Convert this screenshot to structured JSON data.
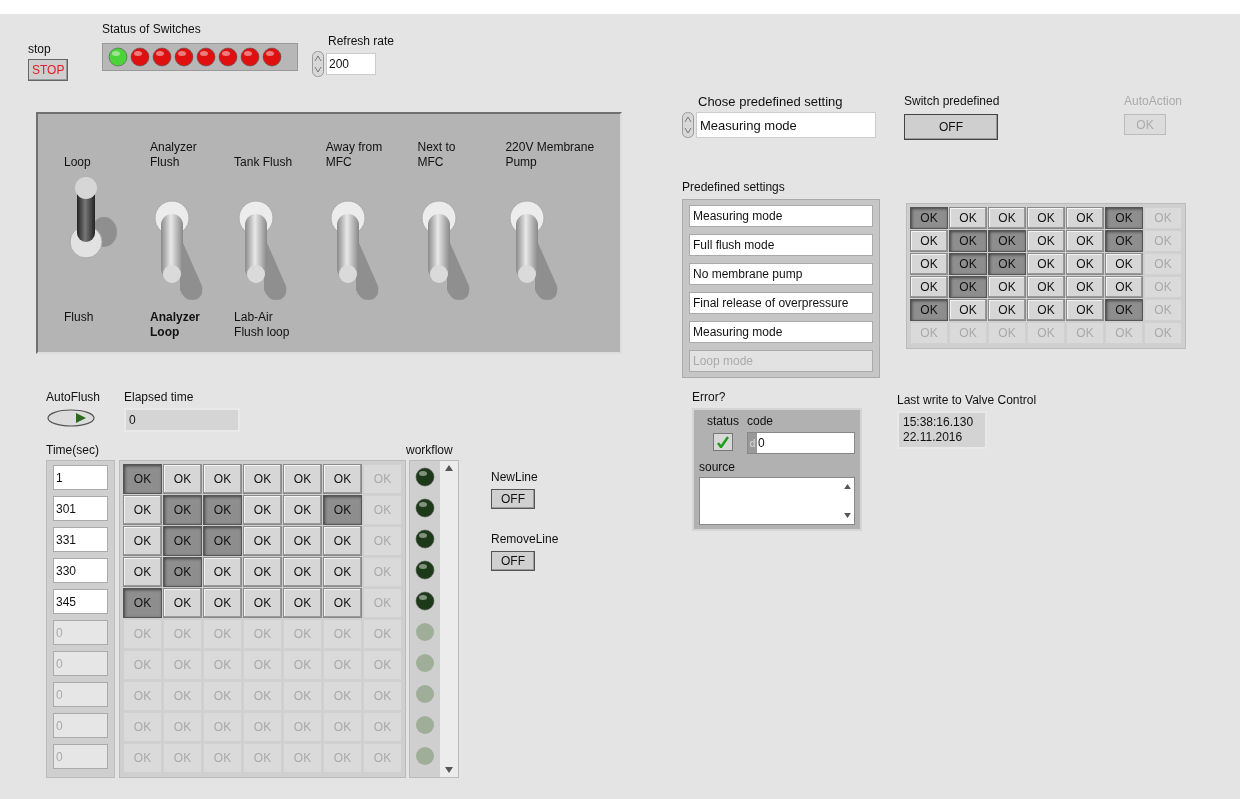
{
  "stop": {
    "label": "stop",
    "button": "STOP"
  },
  "status_of_switches": {
    "label": "Status of Switches",
    "leds": [
      {
        "on": true
      },
      {
        "on": false
      },
      {
        "on": false
      },
      {
        "on": false
      },
      {
        "on": false
      },
      {
        "on": false
      },
      {
        "on": false
      },
      {
        "on": false
      }
    ]
  },
  "refresh_rate": {
    "label": "Refresh rate",
    "value": "200"
  },
  "switches": [
    {
      "top": "Loop",
      "bottom": "Flush",
      "bottom_bold": false,
      "up": true
    },
    {
      "top": "Analyzer Flush",
      "bottom": "Analyzer Loop",
      "bottom_bold": true,
      "up": false
    },
    {
      "top": "Tank Flush",
      "bottom": "Lab-Air Flush loop",
      "bottom_bold": false,
      "up": false
    },
    {
      "top": "Away from MFC",
      "up": false
    },
    {
      "top": "Next to MFC",
      "up": false
    },
    {
      "top": "220V Membrane Pump",
      "up": false
    }
  ],
  "autoflush": {
    "label": "AutoFlush"
  },
  "elapsed_time": {
    "label": "Elapsed time",
    "value": "0"
  },
  "table": {
    "time_label": "Time(sec)",
    "workflow_label": "workflow",
    "rows": [
      {
        "time": "1",
        "disabled": false,
        "cells": [
          {
            "text": "OK",
            "pressed": true,
            "disabled": false
          },
          {
            "text": "OK",
            "pressed": false,
            "disabled": false
          },
          {
            "text": "OK",
            "pressed": false,
            "disabled": false
          },
          {
            "text": "OK",
            "pressed": false,
            "disabled": false
          },
          {
            "text": "OK",
            "pressed": false,
            "disabled": false
          },
          {
            "text": "OK",
            "pressed": false,
            "disabled": false
          },
          {
            "text": "OK",
            "pressed": false,
            "disabled": true
          }
        ]
      },
      {
        "time": "301",
        "disabled": false,
        "cells": [
          {
            "text": "OK",
            "pressed": false,
            "disabled": false
          },
          {
            "text": "OK",
            "pressed": true,
            "disabled": false
          },
          {
            "text": "OK",
            "pressed": true,
            "disabled": false
          },
          {
            "text": "OK",
            "pressed": false,
            "disabled": false
          },
          {
            "text": "OK",
            "pressed": false,
            "disabled": false
          },
          {
            "text": "OK",
            "pressed": true,
            "disabled": false
          },
          {
            "text": "OK",
            "pressed": false,
            "disabled": true
          }
        ]
      },
      {
        "time": "331",
        "disabled": false,
        "cells": [
          {
            "text": "OK",
            "pressed": false,
            "disabled": false
          },
          {
            "text": "OK",
            "pressed": true,
            "disabled": false
          },
          {
            "text": "OK",
            "pressed": true,
            "disabled": false
          },
          {
            "text": "OK",
            "pressed": false,
            "disabled": false
          },
          {
            "text": "OK",
            "pressed": false,
            "disabled": false
          },
          {
            "text": "OK",
            "pressed": false,
            "disabled": false
          },
          {
            "text": "OK",
            "pressed": false,
            "disabled": true
          }
        ]
      },
      {
        "time": "330",
        "disabled": false,
        "cells": [
          {
            "text": "OK",
            "pressed": false,
            "disabled": false
          },
          {
            "text": "OK",
            "pressed": true,
            "disabled": false
          },
          {
            "text": "OK",
            "pressed": false,
            "disabled": false
          },
          {
            "text": "OK",
            "pressed": false,
            "disabled": false
          },
          {
            "text": "OK",
            "pressed": false,
            "disabled": false
          },
          {
            "text": "OK",
            "pressed": false,
            "disabled": false
          },
          {
            "text": "OK",
            "pressed": false,
            "disabled": true
          }
        ]
      },
      {
        "time": "345",
        "disabled": false,
        "cells": [
          {
            "text": "OK",
            "pressed": true,
            "disabled": false
          },
          {
            "text": "OK",
            "pressed": false,
            "disabled": false
          },
          {
            "text": "OK",
            "pressed": false,
            "disabled": false
          },
          {
            "text": "OK",
            "pressed": false,
            "disabled": false
          },
          {
            "text": "OK",
            "pressed": false,
            "disabled": false
          },
          {
            "text": "OK",
            "pressed": false,
            "disabled": false
          },
          {
            "text": "OK",
            "pressed": false,
            "disabled": true
          }
        ]
      },
      {
        "time": "0",
        "disabled": true,
        "cells": [
          {
            "text": "OK",
            "pressed": false,
            "disabled": true
          },
          {
            "text": "OK",
            "pressed": false,
            "disabled": true
          },
          {
            "text": "OK",
            "pressed": false,
            "disabled": true
          },
          {
            "text": "OK",
            "pressed": false,
            "disabled": true
          },
          {
            "text": "OK",
            "pressed": false,
            "disabled": true
          },
          {
            "text": "OK",
            "pressed": false,
            "disabled": true
          },
          {
            "text": "OK",
            "pressed": false,
            "disabled": true
          }
        ]
      },
      {
        "time": "0",
        "disabled": true,
        "cells": [
          {
            "text": "OK",
            "pressed": false,
            "disabled": true
          },
          {
            "text": "OK",
            "pressed": false,
            "disabled": true
          },
          {
            "text": "OK",
            "pressed": false,
            "disabled": true
          },
          {
            "text": "OK",
            "pressed": false,
            "disabled": true
          },
          {
            "text": "OK",
            "pressed": false,
            "disabled": true
          },
          {
            "text": "OK",
            "pressed": false,
            "disabled": true
          },
          {
            "text": "OK",
            "pressed": false,
            "disabled": true
          }
        ]
      },
      {
        "time": "0",
        "disabled": true,
        "cells": [
          {
            "text": "OK",
            "pressed": false,
            "disabled": true
          },
          {
            "text": "OK",
            "pressed": false,
            "disabled": true
          },
          {
            "text": "OK",
            "pressed": false,
            "disabled": true
          },
          {
            "text": "OK",
            "pressed": false,
            "disabled": true
          },
          {
            "text": "OK",
            "pressed": false,
            "disabled": true
          },
          {
            "text": "OK",
            "pressed": false,
            "disabled": true
          },
          {
            "text": "OK",
            "pressed": false,
            "disabled": true
          }
        ]
      },
      {
        "time": "0",
        "disabled": true,
        "cells": [
          {
            "text": "OK",
            "pressed": false,
            "disabled": true
          },
          {
            "text": "OK",
            "pressed": false,
            "disabled": true
          },
          {
            "text": "OK",
            "pressed": false,
            "disabled": true
          },
          {
            "text": "OK",
            "pressed": false,
            "disabled": true
          },
          {
            "text": "OK",
            "pressed": false,
            "disabled": true
          },
          {
            "text": "OK",
            "pressed": false,
            "disabled": true
          },
          {
            "text": "OK",
            "pressed": false,
            "disabled": true
          }
        ]
      },
      {
        "time": "0",
        "disabled": true,
        "cells": [
          {
            "text": "OK",
            "pressed": false,
            "disabled": true
          },
          {
            "text": "OK",
            "pressed": false,
            "disabled": true
          },
          {
            "text": "OK",
            "pressed": false,
            "disabled": true
          },
          {
            "text": "OK",
            "pressed": false,
            "disabled": true
          },
          {
            "text": "OK",
            "pressed": false,
            "disabled": true
          },
          {
            "text": "OK",
            "pressed": false,
            "disabled": true
          },
          {
            "text": "OK",
            "pressed": false,
            "disabled": true
          }
        ]
      }
    ]
  },
  "new_line": {
    "label": "NewLine",
    "button": "OFF"
  },
  "remove_line": {
    "label": "RemoveLine",
    "button": "OFF"
  },
  "chose_predefined": {
    "label": "Chose predefined setting",
    "value": "Measuring mode"
  },
  "switch_predefined": {
    "label": "Switch predefined",
    "button": "OFF"
  },
  "auto_action": {
    "label": "AutoAction",
    "button": "OK",
    "disabled": true
  },
  "predefined_settings": {
    "label": "Predefined settings",
    "items": [
      {
        "text": "Measuring mode",
        "disabled": false
      },
      {
        "text": "Full flush mode",
        "disabled": false
      },
      {
        "text": "No membrane pump",
        "disabled": false
      },
      {
        "text": "Final release of overpressure",
        "disabled": false
      },
      {
        "text": "Measuring mode",
        "disabled": false
      },
      {
        "text": "Loop mode",
        "disabled": true
      }
    ],
    "grid": [
      [
        {
          "text": "OK",
          "pressed": true,
          "disabled": false
        },
        {
          "text": "OK",
          "pressed": false,
          "disabled": false
        },
        {
          "text": "OK",
          "pressed": false,
          "disabled": false
        },
        {
          "text": "OK",
          "pressed": false,
          "disabled": false
        },
        {
          "text": "OK",
          "pressed": false,
          "disabled": false
        },
        {
          "text": "OK",
          "pressed": true,
          "disabled": false
        },
        {
          "text": "OK",
          "pressed": false,
          "disabled": true
        }
      ],
      [
        {
          "text": "OK",
          "pressed": false,
          "disabled": false
        },
        {
          "text": "OK",
          "pressed": true,
          "disabled": false
        },
        {
          "text": "OK",
          "pressed": true,
          "disabled": false
        },
        {
          "text": "OK",
          "pressed": false,
          "disabled": false
        },
        {
          "text": "OK",
          "pressed": false,
          "disabled": false
        },
        {
          "text": "OK",
          "pressed": true,
          "disabled": false
        },
        {
          "text": "OK",
          "pressed": false,
          "disabled": true
        }
      ],
      [
        {
          "text": "OK",
          "pressed": false,
          "disabled": false
        },
        {
          "text": "OK",
          "pressed": true,
          "disabled": false
        },
        {
          "text": "OK",
          "pressed": true,
          "disabled": false
        },
        {
          "text": "OK",
          "pressed": false,
          "disabled": false
        },
        {
          "text": "OK",
          "pressed": false,
          "disabled": false
        },
        {
          "text": "OK",
          "pressed": false,
          "disabled": false
        },
        {
          "text": "OK",
          "pressed": false,
          "disabled": true
        }
      ],
      [
        {
          "text": "OK",
          "pressed": false,
          "disabled": false
        },
        {
          "text": "OK",
          "pressed": true,
          "disabled": false
        },
        {
          "text": "OK",
          "pressed": false,
          "disabled": false
        },
        {
          "text": "OK",
          "pressed": false,
          "disabled": false
        },
        {
          "text": "OK",
          "pressed": false,
          "disabled": false
        },
        {
          "text": "OK",
          "pressed": false,
          "disabled": false
        },
        {
          "text": "OK",
          "pressed": false,
          "disabled": true
        }
      ],
      [
        {
          "text": "OK",
          "pressed": true,
          "disabled": false
        },
        {
          "text": "OK",
          "pressed": false,
          "disabled": false
        },
        {
          "text": "OK",
          "pressed": false,
          "disabled": false
        },
        {
          "text": "OK",
          "pressed": false,
          "disabled": false
        },
        {
          "text": "OK",
          "pressed": false,
          "disabled": false
        },
        {
          "text": "OK",
          "pressed": true,
          "disabled": false
        },
        {
          "text": "OK",
          "pressed": false,
          "disabled": true
        }
      ],
      [
        {
          "text": "OK",
          "pressed": false,
          "disabled": true
        },
        {
          "text": "OK",
          "pressed": false,
          "disabled": true
        },
        {
          "text": "OK",
          "pressed": false,
          "disabled": true
        },
        {
          "text": "OK",
          "pressed": false,
          "disabled": true
        },
        {
          "text": "OK",
          "pressed": false,
          "disabled": true
        },
        {
          "text": "OK",
          "pressed": false,
          "disabled": true
        },
        {
          "text": "OK",
          "pressed": false,
          "disabled": true
        }
      ]
    ]
  },
  "error": {
    "label": "Error?",
    "status_label": "status",
    "status_ok": true,
    "code_label": "code",
    "code_radix": "d",
    "code": "0",
    "source_label": "source"
  },
  "last_write": {
    "label": "Last write to Valve Control",
    "lines": [
      "15:38:16.130",
      "22.11.2016"
    ]
  }
}
